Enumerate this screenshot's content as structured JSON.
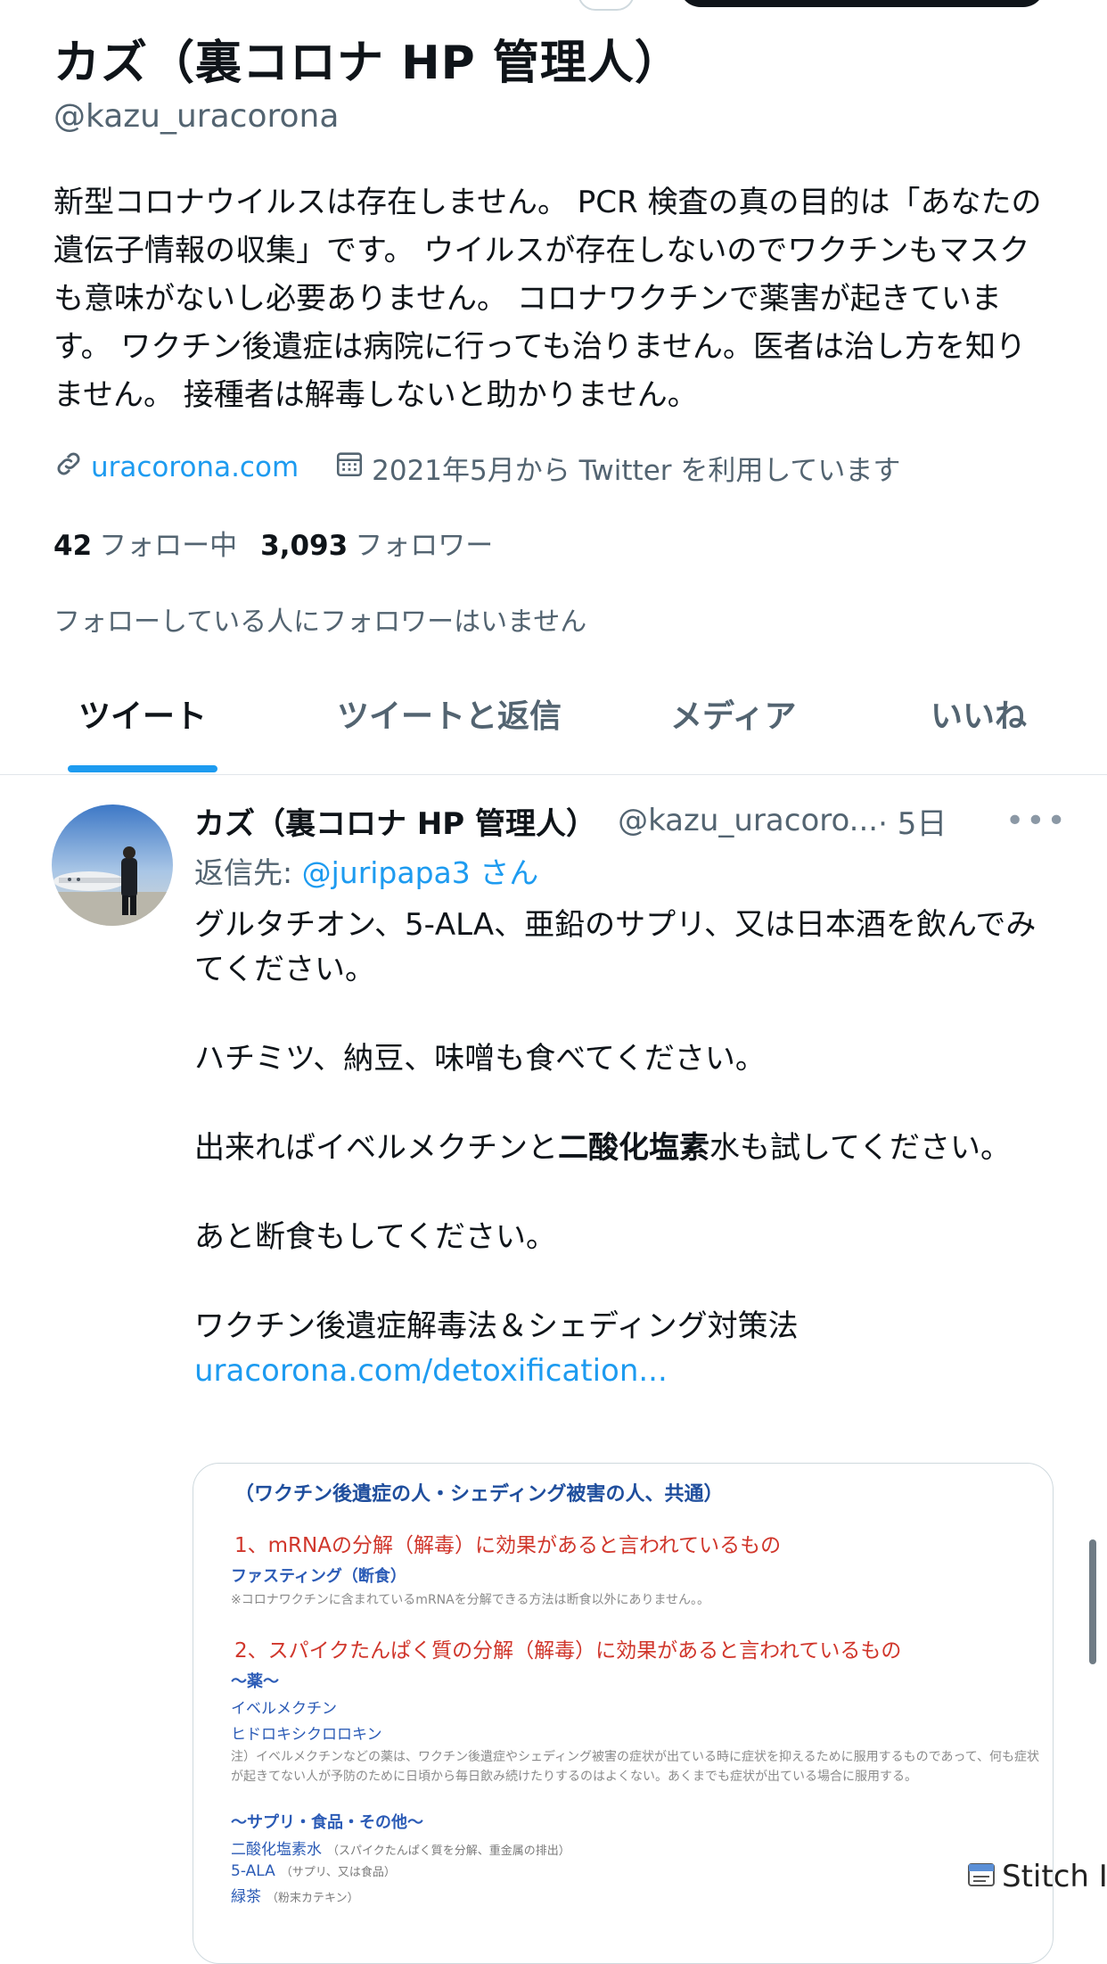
{
  "profile": {
    "name": "カズ（裏コロナ HP 管理人）",
    "handle": "@kazu_uracorona",
    "bio": "新型コロナウイルスは存在しません。 PCR 検査の真の目的は「あなたの遺伝子情報の収集」です。 ウイルスが存在しないのでワクチンもマスクも意味がないし必要ありません。 コロナワクチンで薬害が起きています。 ワクチン後遺症は病院に行っても治りません。医者は治し方を知りません。 接種者は解毒しないと助かりません。",
    "website": "uracorona.com",
    "joined": "2021年5月から Twitter を利用しています",
    "following_count": "42",
    "following_label": "フォロー中",
    "followers_count": "3,093",
    "followers_label": "フォロワー",
    "followers_you_know": "フォローしている人にフォロワーはいません"
  },
  "tabs": [
    {
      "label": "ツイート",
      "active": true
    },
    {
      "label": "ツイートと返信",
      "active": false
    },
    {
      "label": "メディア",
      "active": false
    },
    {
      "label": "いいね",
      "active": false
    }
  ],
  "tweet": {
    "author_name": "カズ（裏コロナ HP 管理人）",
    "author_handle": "@kazu_uracoro...",
    "time": " · 5日",
    "more": "•••",
    "reply_prefix": "返信先: ",
    "reply_mention": "@juripapa3 さん",
    "p1": "グルタチオン、5-ALA、亜鉛のサプリ、又は日本酒を飲んでみてください。",
    "p2": "ハチミツ、納豆、味噌も食べてください。",
    "p3_a": "出来ればイベルメクチンと",
    "p3_bold": "二酸化塩素",
    "p3_b": "水も試してください。",
    "p4": "あと断食もしてください。",
    "p5": "ワクチン後遺症解毒法＆シェディング対策法",
    "link": "uracorona.com/detoxification..."
  },
  "card": {
    "title": "（ワクチン後遺症の人・シェディング被害の人、共通）",
    "h1": "1、mRNAの分解（解毒）に効果があると言われているもの",
    "h1_item": "ファスティング（断食）",
    "h1_note": "※コロナワクチンに含まれているmRNAを分解できる方法は断食以外にありません。。",
    "h2": "2、スパイクたんぱく質の分解（解毒）に効果があると言われているもの",
    "drugs_label": "〜薬〜",
    "drug1": "イベルメクチン",
    "drug2": "ヒドロキシクロロキン",
    "drugs_note": "注）イベルメクチンなどの薬は、ワクチン後遺症やシェディング被害の症状が出ている時に症状を抑えるために服用するものであって、何も症状が起きてない人が予防のために日頃から毎日飲み続けたりするのはよくない。あくまでも症状が出ている場合に服用する。",
    "supp_label": "〜サプリ・食品・その他〜",
    "supp1": "二酸化塩素水",
    "supp1_note": "（スパイクたんぱく質を分解、重金属の排出）",
    "supp2": "5-ALA",
    "supp2_note": "（サプリ、又は食品）",
    "supp3": "緑茶",
    "supp3_note": "（粉末カテキン）"
  },
  "watermark": "Stitch It!",
  "colors": {
    "accent": "#1d9bf0",
    "text": "#0f1419",
    "muted": "#536471",
    "card_red": "#d0362b",
    "card_blue": "#2b5bb6"
  }
}
